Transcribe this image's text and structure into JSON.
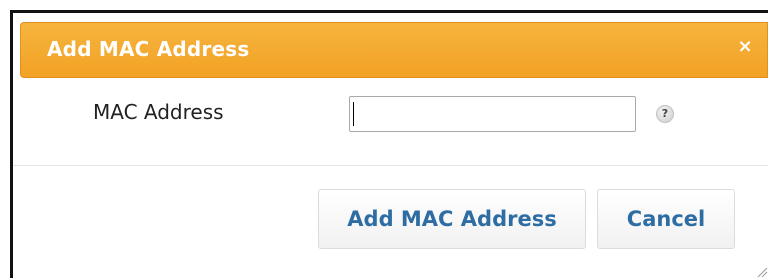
{
  "dialog": {
    "title": "Add MAC Address",
    "close_glyph": "×",
    "field": {
      "label": "MAC Address",
      "value": "",
      "placeholder": ""
    },
    "help_glyph": "?",
    "buttons": {
      "add_label": "Add MAC Address",
      "cancel_label": "Cancel"
    }
  },
  "colors": {
    "titlebar": "#f2a224",
    "title_text": "#ffffff",
    "button_text": "#2e6da4"
  },
  "icons": {
    "close": "close-icon",
    "help": "help-icon",
    "resize": "resize-grip-icon"
  }
}
